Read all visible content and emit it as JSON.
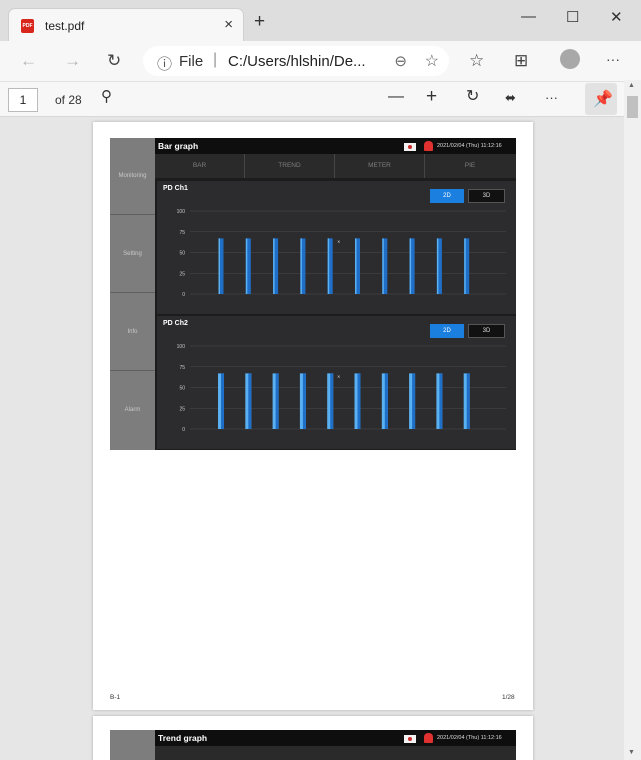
{
  "tab": {
    "title": "test.pdf",
    "close": "×",
    "new_tab": "+"
  },
  "window": {
    "minimize": "—",
    "maximize": "☐",
    "close": "✕"
  },
  "nav": {
    "back": "←",
    "forward": "→",
    "refresh": "↻",
    "more": "···"
  },
  "address": {
    "info": "ⓘ",
    "scheme": "File",
    "separator": "|",
    "url": "C:/Users/hlshin/De..."
  },
  "pdf_toolbar": {
    "page": "1",
    "of": "of 28",
    "zoom_out": "—",
    "zoom_in": "+",
    "more": "···"
  },
  "page1": {
    "header_title": "Bar graph",
    "datetime": "2021/02/04 (Thu) 11:12:16",
    "sidebar": [
      "Monitoring",
      "Setting",
      "Info",
      "Alarm"
    ],
    "tabs": [
      "BAR",
      "TREND",
      "METER",
      "PIE"
    ],
    "btn_2d": "2D",
    "btn_3d": "3D",
    "footer_left": "B-1",
    "footer_right": "1/28"
  },
  "page2": {
    "header_title": "Trend graph",
    "datetime": "2021/02/04 (Thu) 11:12:16"
  },
  "colors": {
    "accent": "#1b7fe0",
    "bar_dark": "#1f6fc9",
    "bar_light": "#5ab1f2"
  },
  "chart_data": [
    {
      "type": "bar",
      "title": "PD Ch1",
      "yticks": [
        "100",
        "75",
        "50",
        "25",
        "0"
      ],
      "ylim": [
        0,
        100
      ],
      "values": [
        67,
        67,
        67,
        67,
        67,
        67,
        67,
        67,
        67,
        67
      ],
      "marker": "×",
      "style": "flat-2D"
    },
    {
      "type": "bar",
      "title": "PD Ch2",
      "yticks": [
        "100",
        "75",
        "50",
        "25",
        "0"
      ],
      "ylim": [
        0,
        100
      ],
      "values": [
        67,
        67,
        67,
        67,
        67,
        67,
        67,
        67,
        67,
        67
      ],
      "marker": "×",
      "style": "highlighted"
    }
  ]
}
